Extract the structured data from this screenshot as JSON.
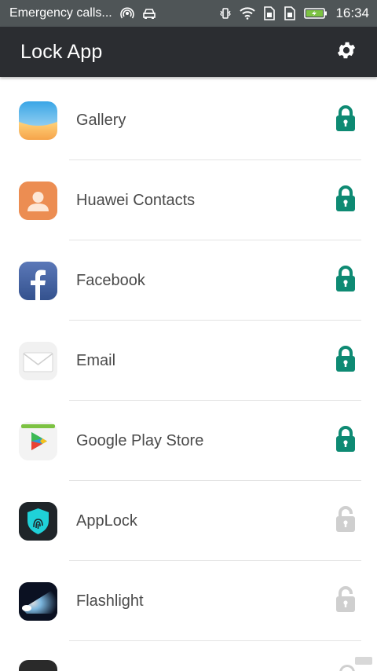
{
  "status_bar": {
    "carrier_text": "Emergency calls...",
    "time": "16:34",
    "icons": [
      "hotspot-icon",
      "car-mode-icon",
      "vibrate-icon",
      "wifi-icon",
      "sim1-icon",
      "sim2-icon",
      "battery-charging-icon"
    ]
  },
  "app_bar": {
    "title": "Lock App",
    "settings_icon": "gear-icon"
  },
  "colors": {
    "locked": "#0e8a73",
    "unlocked": "#cfcfcf",
    "appbar": "#2b2d31",
    "statusbar": "#4f5557"
  },
  "apps": [
    {
      "label": "Gallery",
      "icon": "gallery-icon",
      "locked": true
    },
    {
      "label": "Huawei Contacts",
      "icon": "contacts-icon",
      "locked": true
    },
    {
      "label": "Facebook",
      "icon": "facebook-icon",
      "locked": true
    },
    {
      "label": "Email",
      "icon": "email-icon",
      "locked": true
    },
    {
      "label": "Google Play Store",
      "icon": "play-store-icon",
      "locked": true
    },
    {
      "label": "AppLock",
      "icon": "applock-icon",
      "locked": false
    },
    {
      "label": "Flashlight",
      "icon": "flashlight-icon",
      "locked": false
    }
  ]
}
